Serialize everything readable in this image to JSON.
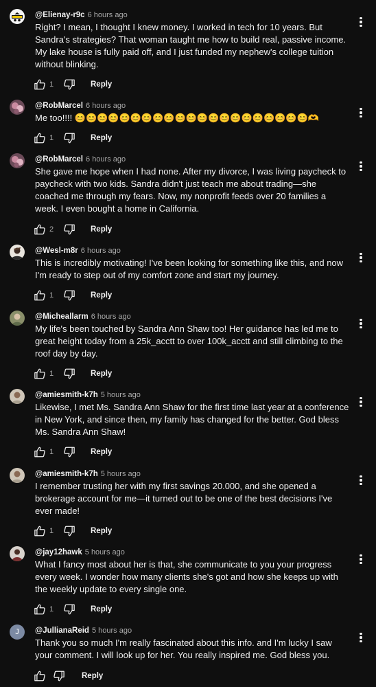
{
  "comments": [
    {
      "handle": "@Elienay-r9c",
      "time": "6 hours ago",
      "text": "Right? I mean, I thought I knew money. I worked in tech for 10 years. But Sandra's strategies? That woman taught me how to build real, passive income. My lake house is fully paid off, and I just funded my nephew's college tuition without blinking.",
      "likes": "1",
      "reply": "Reply",
      "avatar": "avatar-elienay"
    },
    {
      "handle": "@RobMarcel",
      "time": "6 hours ago",
      "text": "Me too!!!! 😊😊😊😊😊😊😊😊😊😊😊😊😊😊😊😊😊😊😊😊😊🫶",
      "likes": "1",
      "reply": "Reply",
      "avatar": "avatar-robmarcel"
    },
    {
      "handle": "@RobMarcel",
      "time": "6 hours ago",
      "text": "She gave me hope when I had none. After my divorce, I was living paycheck to paycheck with two kids. Sandra didn't just teach me about trading—she coached me through my fears. Now, my nonprofit feeds over 20 families a week. I even bought a home in California.",
      "likes": "2",
      "reply": "Reply",
      "avatar": "avatar-robmarcel"
    },
    {
      "handle": "@Wesl-m8r",
      "time": "6 hours ago",
      "text": "This is incredibly motivating! I've been looking for something like this, and now I'm ready to step out of my comfort zone and start my journey.",
      "likes": "1",
      "reply": "Reply",
      "avatar": "avatar-wesl"
    },
    {
      "handle": "@Micheallarm",
      "time": "6 hours ago",
      "text": "My life's been touched by Sandra Ann Shaw too! Her guidance has led me to great height today from a 25k_acctt to over 100k_acctt and still climbing to the roof day by day.",
      "likes": "1",
      "reply": "Reply",
      "avatar": "avatar-micheallarm"
    },
    {
      "handle": "@amiesmith-k7h",
      "time": "5 hours ago",
      "text": "Likewise, I met Ms. Sandra Ann Shaw for the first time last year at a conference in New York, and since then, my family has changed for the better. God bless Ms. Sandra Ann Shaw!",
      "likes": "1",
      "reply": "Reply",
      "avatar": "avatar-amiesmith"
    },
    {
      "handle": "@amiesmith-k7h",
      "time": "5 hours ago",
      "text": "I remember trusting her with my first savings 20.000, and she opened a brokerage account for me—it turned out to be one of the best decisions I've ever made!",
      "likes": "1",
      "reply": "Reply",
      "avatar": "avatar-amiesmith"
    },
    {
      "handle": "@jay12hawk",
      "time": "5 hours ago",
      "text": "What I fancy most about her is that, she communicate to you your progress every week. I wonder how many clients she's got and how she keeps up with the weekly update to every single one.",
      "likes": "1",
      "reply": "Reply",
      "avatar": "avatar-jay12hawk"
    },
    {
      "handle": "@JullianaReid",
      "time": "5 hours ago",
      "text": "Thank you so much I'm really fascinated about this info. and I'm lucky I saw your comment. I will look up for her. You really inspired me. God bless you.",
      "likes": "",
      "reply": "Reply",
      "avatar": "avatar-initial",
      "avatar_initial": "J"
    }
  ],
  "colors": {
    "background": "#0f0f0f",
    "text": "#f1f1f1",
    "secondary_text": "#aaaaaa",
    "initial_avatar": "#7c8aa3"
  },
  "icons": {
    "like": "thumbs-up-icon",
    "dislike": "thumbs-down-icon",
    "more": "more-vertical-icon"
  }
}
